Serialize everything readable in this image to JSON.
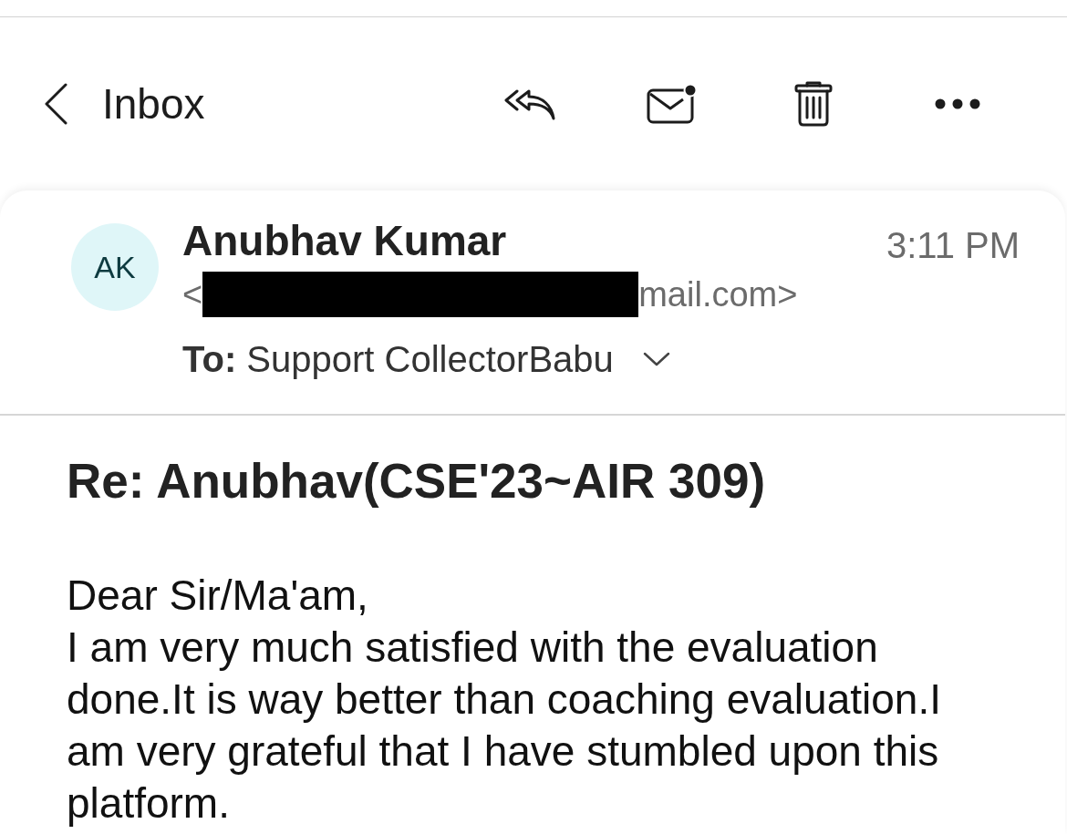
{
  "nav": {
    "back_label": "Inbox"
  },
  "message": {
    "sender": {
      "initials": "AK",
      "name": "Anubhav Kumar",
      "email_prefix": "<",
      "email_suffix": "mail.com>",
      "redacted": true
    },
    "time": "3:11 PM",
    "recipient_line": "**To:** Support CollectorBabu",
    "subject": "Re: Anubhav(CSE'23~AIR 309)",
    "body": [
      "Dear Sir/Ma'am,",
      "I am very much satisfied with the evaluation done.It is way better than coaching evaluation.I am very grateful that I have stumbled upon this platform."
    ]
  }
}
